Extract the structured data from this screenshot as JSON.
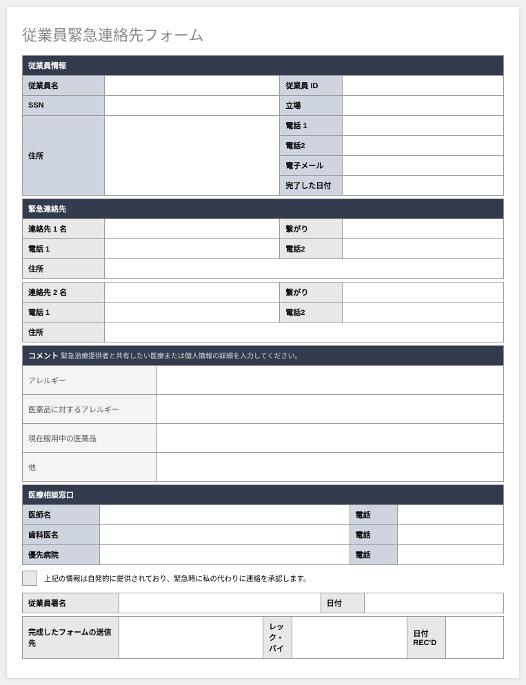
{
  "title": "従業員緊急連絡先フォーム",
  "employee": {
    "header": "従業員情報",
    "name": "従業員名",
    "id": "従業員 ID",
    "ssn": "SSN",
    "position": "立場",
    "address": "住所",
    "phone1": "電話 1",
    "phone2": "電話2",
    "email": "電子メール",
    "completed": "完了した日付"
  },
  "emergency": {
    "header": "緊急連絡先",
    "contact1": "連絡先 1 名",
    "contact2": "連絡先 2 名",
    "relation": "繋がり",
    "phone1": "電話 1",
    "phone2": "電話2",
    "address": "住所"
  },
  "comments": {
    "header": "コメント",
    "sub": "緊急治療提供者と共有したい医療または個人情報の詳細を入力してください。",
    "allergies": "アレルギー",
    "drugAllergies": "医薬品に対するアレルギー",
    "currentMeds": "現在服用中の医薬品",
    "other": "他"
  },
  "medical": {
    "header": "医療相談窓口",
    "doctor": "医師名",
    "dentist": "歯科医名",
    "hospital": "優先病院",
    "phone": "電話"
  },
  "consent": "上記の情報は自発的に提供されており、緊急時に私の代わりに連絡を承認します。",
  "signature": {
    "name": "従業員署名",
    "date": "日付",
    "sendTo": "完成したフォームの送信先",
    "recBy": "レック・バイ",
    "dateRecd": "日付 REC'D"
  }
}
